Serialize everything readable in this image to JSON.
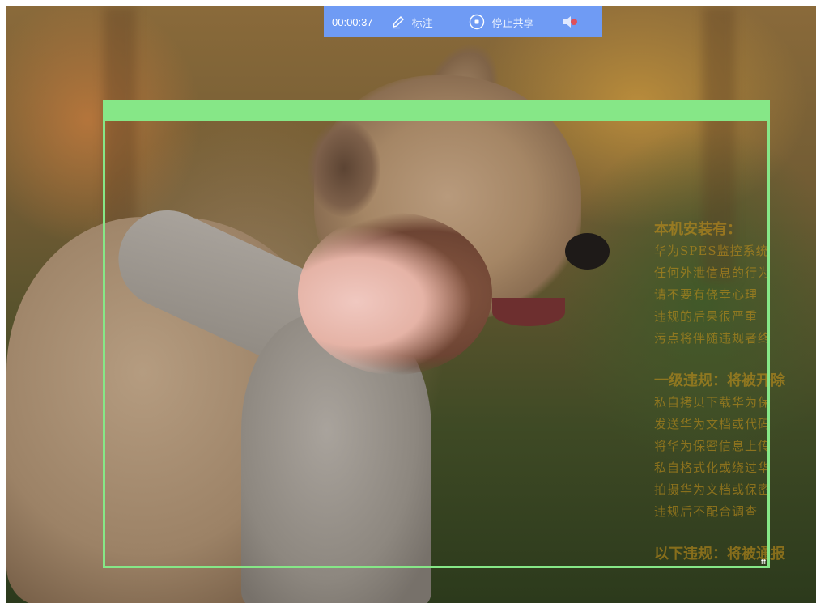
{
  "toolbar": {
    "timer": "00:00:37",
    "annotate_label": "标注",
    "annotate_icon": "pencil-icon",
    "stop_share_label": "停止共享",
    "stop_icon": "stop-circle-icon",
    "audio_icon": "speaker-muted-icon",
    "background_color": "#6f9bf4"
  },
  "capture_frame": {
    "color": "#86e787"
  },
  "watermark": {
    "color": "#cd9619",
    "section1_title": "本机安装有：",
    "section1_lines": [
      "华为SPES监控系统",
      "任何外泄信息的行为",
      "请不要有侥幸心理",
      "违规的后果很严重",
      "污点将伴随违规者终"
    ],
    "section2_title": "一级违规：将被开除",
    "section2_lines": [
      "私自拷贝下载华为保",
      "发送华为文档或代码",
      "将华为保密信息上传",
      "私自格式化或绕过华",
      "拍摄华为文档或保密",
      "违规后不配合调查"
    ],
    "section3_title": "以下违规：将被通报"
  }
}
